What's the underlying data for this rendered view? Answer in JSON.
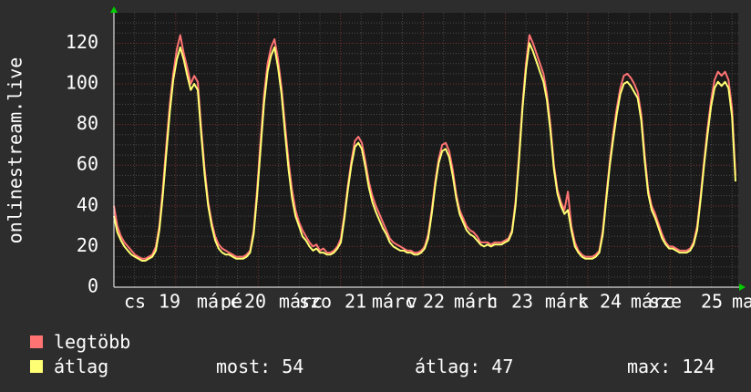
{
  "chart_data": {
    "type": "line",
    "ylabel": "onlinestream.live",
    "ylim": [
      0,
      135
    ],
    "yticks": [
      0,
      20,
      40,
      60,
      80,
      100,
      120
    ],
    "grid": true,
    "x_tick_labels": [
      "cs",
      "19",
      "márc",
      "pé",
      "20",
      "márc",
      "sz",
      "szo",
      "21",
      "márc",
      "v",
      "22",
      "márc",
      "h",
      "23",
      "márc",
      "k",
      "24",
      "márc",
      "sze",
      "25",
      "ma"
    ],
    "series": [
      {
        "name": "legtöbb",
        "color": "#ff7373",
        "values": [
          40,
          30,
          25,
          22,
          20,
          18,
          16,
          15,
          14,
          14,
          15,
          16,
          20,
          30,
          48,
          70,
          90,
          105,
          117,
          124,
          115,
          108,
          100,
          104,
          101,
          78,
          58,
          42,
          32,
          25,
          21,
          19,
          18,
          17,
          16,
          15,
          15,
          15,
          16,
          18,
          28,
          48,
          72,
          95,
          110,
          118,
          122,
          112,
          98,
          80,
          62,
          48,
          38,
          32,
          28,
          25,
          22,
          20,
          21,
          18,
          19,
          17,
          17,
          18,
          20,
          24,
          36,
          50,
          62,
          72,
          74,
          71,
          62,
          52,
          45,
          40,
          36,
          32,
          28,
          24,
          22,
          21,
          20,
          19,
          18,
          18,
          17,
          17,
          18,
          20,
          26,
          38,
          52,
          63,
          70,
          71,
          67,
          58,
          46,
          38,
          34,
          30,
          28,
          27,
          25,
          22,
          22,
          22,
          21,
          22,
          22,
          22,
          23,
          24,
          28,
          42,
          65,
          90,
          110,
          124,
          120,
          115,
          110,
          105,
          95,
          80,
          60,
          48,
          42,
          38,
          47,
          30,
          22,
          18,
          16,
          15,
          15,
          15,
          16,
          18,
          28,
          45,
          62,
          76,
          88,
          98,
          104,
          105,
          103,
          100,
          96,
          85,
          65,
          48,
          40,
          36,
          31,
          26,
          22,
          20,
          20,
          19,
          18,
          18,
          18,
          19,
          22,
          30,
          45,
          62,
          78,
          92,
          102,
          106,
          104,
          106,
          102,
          88,
          55
        ],
        "values_legend": "legtöbb"
      },
      {
        "name": "átlag",
        "color": "#ffff73",
        "values": [
          35,
          27,
          23,
          20,
          18,
          16,
          15,
          14,
          13,
          13,
          14,
          15,
          18,
          28,
          45,
          66,
          86,
          102,
          112,
          118,
          112,
          104,
          97,
          100,
          97,
          75,
          55,
          40,
          30,
          23,
          19,
          17,
          16,
          16,
          15,
          14,
          14,
          14,
          15,
          17,
          26,
          45,
          68,
          91,
          106,
          114,
          118,
          108,
          95,
          76,
          58,
          44,
          35,
          30,
          25,
          23,
          20,
          18,
          19,
          17,
          17,
          16,
          16,
          17,
          19,
          22,
          34,
          48,
          60,
          69,
          71,
          68,
          59,
          49,
          42,
          37,
          33,
          29,
          26,
          22,
          20,
          19,
          18,
          18,
          17,
          17,
          16,
          16,
          17,
          19,
          24,
          36,
          50,
          61,
          67,
          68,
          64,
          55,
          44,
          36,
          32,
          28,
          26,
          25,
          23,
          21,
          20,
          21,
          20,
          21,
          21,
          21,
          22,
          23,
          27,
          40,
          62,
          88,
          107,
          120,
          116,
          111,
          106,
          101,
          92,
          77,
          58,
          46,
          40,
          36,
          38,
          28,
          20,
          17,
          15,
          14,
          14,
          14,
          15,
          17,
          26,
          43,
          60,
          73,
          85,
          95,
          100,
          101,
          99,
          96,
          93,
          82,
          62,
          46,
          38,
          34,
          29,
          24,
          21,
          19,
          19,
          18,
          17,
          17,
          17,
          18,
          21,
          28,
          43,
          60,
          75,
          89,
          98,
          101,
          99,
          101,
          98,
          84,
          52
        ]
      }
    ]
  },
  "legend": {
    "items": [
      {
        "label": "legtöbb",
        "color": "#ff7373"
      },
      {
        "label": "átlag",
        "color": "#ffff73"
      }
    ],
    "stats": {
      "most": "most: 54",
      "atlag": "átlag: 47",
      "max": "max: 124"
    }
  }
}
